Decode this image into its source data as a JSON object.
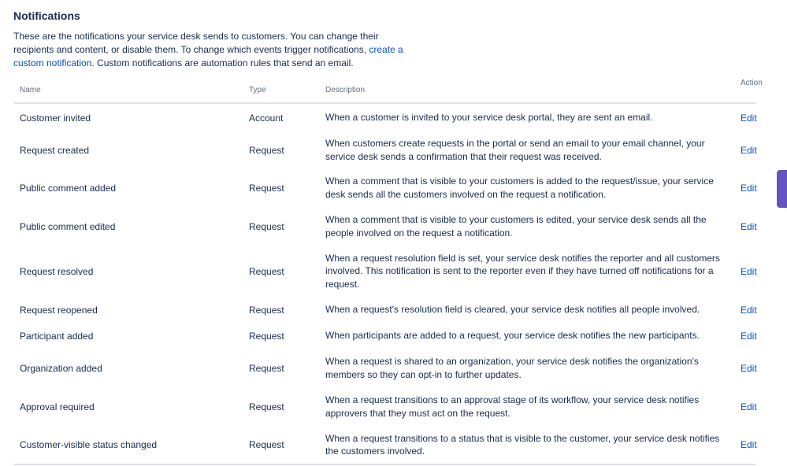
{
  "header": {
    "title": "Notifications",
    "intro_text_1": "These are the notifications your service desk sends to customers. You can change their recipients and content, or disable them. To change which events trigger notifications, ",
    "intro_link": "create a custom notification",
    "intro_text_2": ". Custom notifications are automation rules that send an email."
  },
  "table": {
    "columns": {
      "name": "Name",
      "type": "Type",
      "description": "Description",
      "action": "Action"
    },
    "rows": [
      {
        "name": "Customer invited",
        "type": "Account",
        "description": "When a customer is invited to your service desk portal, they are sent an email.",
        "action": "Edit"
      },
      {
        "name": "Request created",
        "type": "Request",
        "description": "When customers create requests in the portal or send an email to your email channel, your service desk sends a confirmation that their request was received.",
        "action": "Edit"
      },
      {
        "name": "Public comment added",
        "type": "Request",
        "description": "When a comment that is visible to your customers is added to the request/issue, your service desk sends all the customers involved on the request a notification.",
        "action": "Edit"
      },
      {
        "name": "Public comment edited",
        "type": "Request",
        "description": "When a comment that is visible to your customers is edited, your service desk sends all the people involved on the request a notification.",
        "action": "Edit"
      },
      {
        "name": "Request resolved",
        "type": "Request",
        "description": "When a request resolution field is set, your service desk notifies the reporter and all customers involved. This notification is sent to the reporter even if they have turned off notifications for a request.",
        "action": "Edit"
      },
      {
        "name": "Request reopened",
        "type": "Request",
        "description": "When a request's resolution field is cleared, your service desk notifies all people involved.",
        "action": "Edit"
      },
      {
        "name": "Participant added",
        "type": "Request",
        "description": "When participants are added to a request, your service desk notifies the new participants.",
        "action": "Edit"
      },
      {
        "name": "Organization added",
        "type": "Request",
        "description": "When a request is shared to an organization, your service desk notifies the organization's members so they can opt-in to further updates.",
        "action": "Edit"
      },
      {
        "name": "Approval required",
        "type": "Request",
        "description": "When a request transitions to an approval stage of its workflow, your service desk notifies approvers that they must act on the request.",
        "action": "Edit"
      },
      {
        "name": "Customer-visible status changed",
        "type": "Request",
        "description": "When a request transitions to a status that is visible to the customer, your service desk notifies the customers involved.",
        "action": "Edit"
      }
    ]
  },
  "colors": {
    "text": "#172b4d",
    "link": "#0052cc",
    "muted": "#5e6c84",
    "divider": "#dfe1e6",
    "side_tab": "#6554c0"
  }
}
